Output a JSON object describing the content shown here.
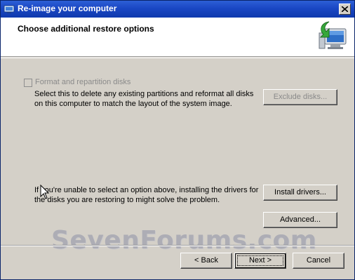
{
  "window": {
    "title": "Re-image your computer",
    "close_symbol": "✕"
  },
  "header": {
    "title": "Choose additional restore options",
    "icon": "computer-restore-icon"
  },
  "options": {
    "format_checkbox_label": "Format and repartition disks",
    "format_checked": false,
    "format_description": "Select this to delete any existing partitions and reformat all disks on this computer to match the layout of the system image.",
    "exclude_button": "Exclude disks...",
    "help_text": "If you're unable to select an option above, installing the drivers for the disks you are restoring to might solve the problem.",
    "install_drivers_button": "Install drivers...",
    "advanced_button": "Advanced..."
  },
  "footer": {
    "back_button": "< Back",
    "next_button": "Next >",
    "cancel_button": "Cancel"
  },
  "watermark": "SevenForums.com",
  "colors": {
    "titlebar": "#1a47c4",
    "dialog_bg": "#d4d0c8",
    "disabled_text": "#8a8a8a"
  }
}
